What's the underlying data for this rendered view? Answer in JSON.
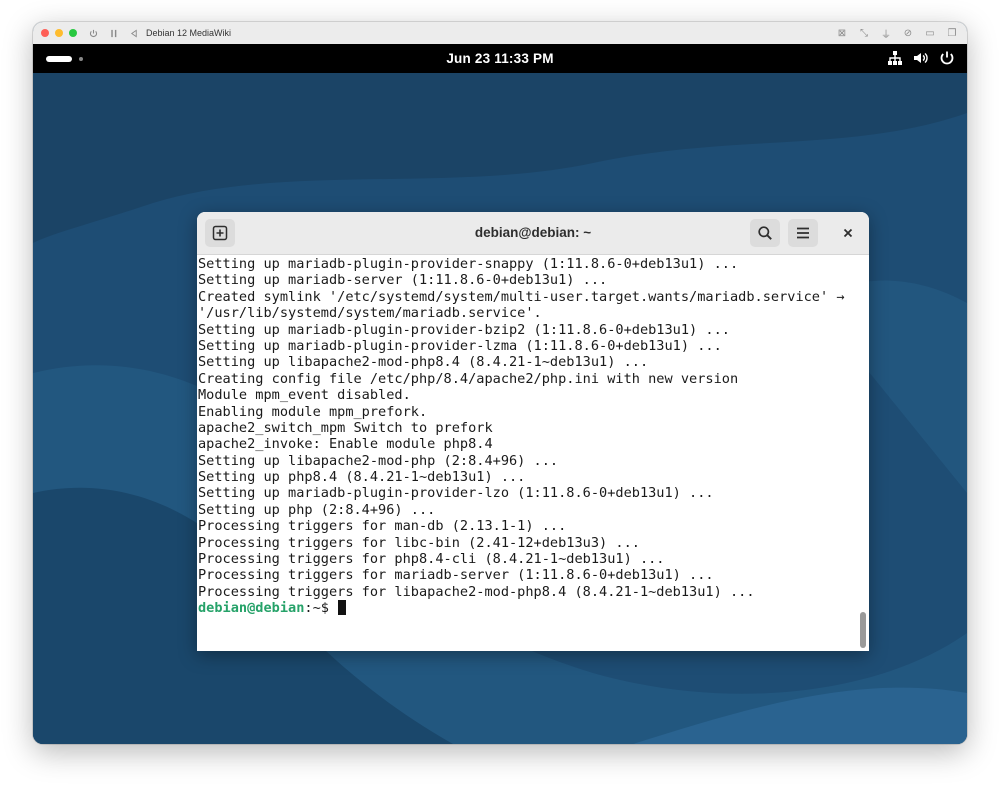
{
  "vm": {
    "title": "Debian 12 MediaWiki"
  },
  "topbar": {
    "clock": "Jun 23  11:33 PM",
    "icons": [
      "network-icon",
      "volume-icon",
      "power-icon"
    ]
  },
  "terminal": {
    "title": "debian@debian: ~",
    "lines": [
      "Setting up mariadb-plugin-provider-snappy (1:11.8.6-0+deb13u1) ...",
      "Setting up mariadb-server (1:11.8.6-0+deb13u1) ...",
      "Created symlink '/etc/systemd/system/multi-user.target.wants/mariadb.service' →",
      "'/usr/lib/systemd/system/mariadb.service'.",
      "Setting up mariadb-plugin-provider-bzip2 (1:11.8.6-0+deb13u1) ...",
      "Setting up mariadb-plugin-provider-lzma (1:11.8.6-0+deb13u1) ...",
      "Setting up libapache2-mod-php8.4 (8.4.21-1~deb13u1) ...",
      "Creating config file /etc/php/8.4/apache2/php.ini with new version",
      "Module mpm_event disabled.",
      "Enabling module mpm_prefork.",
      "apache2_switch_mpm Switch to prefork",
      "apache2_invoke: Enable module php8.4",
      "Setting up libapache2-mod-php (2:8.4+96) ...",
      "Setting up php8.4 (8.4.21-1~deb13u1) ...",
      "Setting up mariadb-plugin-provider-lzo (1:11.8.6-0+deb13u1) ...",
      "Setting up php (2:8.4+96) ...",
      "Processing triggers for man-db (2.13.1-1) ...",
      "Processing triggers for libc-bin (2.41-12+deb13u3) ...",
      "Processing triggers for php8.4-cli (8.4.21-1~deb13u1) ...",
      "Processing triggers for mariadb-server (1:11.8.6-0+deb13u1) ...",
      "Processing triggers for libapache2-mod-php8.4 (8.4.21-1~deb13u1) ..."
    ],
    "prompt_user": "debian@debian",
    "prompt_path": ":~$ "
  },
  "colors": {
    "prompt": "#26a269",
    "desktop": "#1e4d74"
  }
}
